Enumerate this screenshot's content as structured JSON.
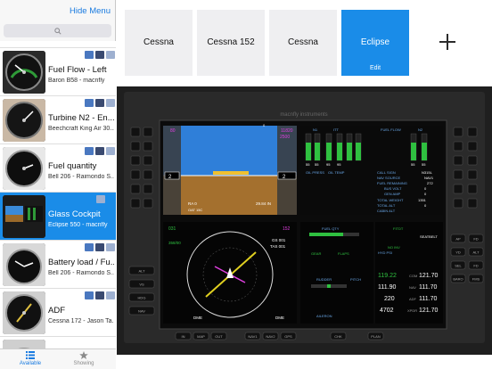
{
  "sidebar": {
    "hide_menu": "Hide Menu",
    "items": [
      {
        "title": "",
        "subtitle": ""
      },
      {
        "title": "Fuel Flow - Left",
        "subtitle": "Baron B58 - macnfly"
      },
      {
        "title": "Turbine N2 - En...",
        "subtitle": "Beechcraft King Air 30..."
      },
      {
        "title": "Fuel quantity",
        "subtitle": "Bell 206 - Raimondo S..."
      },
      {
        "title": "Glass Cockpit",
        "subtitle": "Eclipse 550 - macnfly"
      },
      {
        "title": "Battery load / Fu...",
        "subtitle": "Bell 206 - Raimondo S..."
      },
      {
        "title": "ADF",
        "subtitle": "Cessna 172 - Jason Ta..."
      }
    ]
  },
  "tabbar": {
    "available": "Available",
    "showing": "Showing"
  },
  "panels": {
    "tiles": [
      {
        "label": "Cessna"
      },
      {
        "label": "Cessna 152"
      },
      {
        "label": "Cessna"
      },
      {
        "label": "Eclipse",
        "edit": "Edit"
      }
    ]
  },
  "cockpit": {
    "brand": "macnfly instruments",
    "pfd": {
      "speed_top": "80",
      "alt_top": "11820",
      "alt_bug": "2500",
      "speed": "2",
      "alt": "2",
      "baro": "29.84 IN",
      "dh": "RA 0",
      "oat": "OAT 15C",
      "hdg": "DME",
      "fpa": "0"
    },
    "engine": {
      "labels": [
        "N1",
        "ITT",
        "FUEL FLOW",
        "N2",
        "OIL PRESS",
        "OIL TEMP",
        "CALL SIGN",
        "NAV SOURCE",
        "FUEL REMAINING",
        "BUS VOLT",
        "GEN AMP",
        "TOTAL WEIGHT",
        "TOTAL ALT",
        "CABIN ALT"
      ],
      "values": [
        "55",
        "55",
        "95",
        "95",
        "55",
        "55",
        "N315L",
        "NAV1",
        "272",
        "0",
        "0",
        "1351",
        "0"
      ]
    },
    "hsi": {
      "hdg": "031",
      "crs": "152",
      "wind": "358/00",
      "gs": "GS 001",
      "tas": "TAS 001",
      "dme_left": "DME",
      "dme_right": "DME"
    },
    "systems": {
      "fuel_qty": "FUEL QTY",
      "gear": "GEAR",
      "flaps": "FLAPS",
      "rudder": "RUDDER",
      "pitch": "PITCH",
      "aileron": "AILERON",
      "fitdt": "FITDT",
      "seatbelt": "SEATBELT",
      "no_inv": "NO INV",
      "hyd": "HYD PSI"
    },
    "radio": {
      "com1_active": "119.22",
      "com1_stby": "121.70",
      "nav1_active": "111.90",
      "nav1_stby": "111.70",
      "adf": "220",
      "xpdr": "4702",
      "com_label": "COM",
      "nav_label": "NAV",
      "adf_label": "ADF",
      "xpdr_label": "XPDR",
      "vor": "111.70",
      "stby2": "121.70"
    },
    "buttons": [
      "IN",
      "MAP",
      "OUT",
      "NAV1",
      "NAV2",
      "GPS",
      "CHK",
      "PLAN"
    ],
    "side_left": [
      "ALT",
      "VS",
      "HDG",
      "NAV"
    ],
    "side_right": [
      "AP",
      "FD",
      "YD",
      "ALT",
      "SEL",
      "FD",
      "BARO",
      "FMS"
    ]
  }
}
